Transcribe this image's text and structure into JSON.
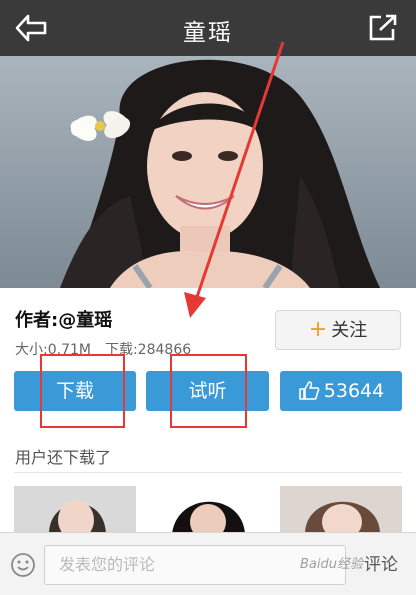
{
  "header": {
    "title": "童瑶"
  },
  "song": {
    "author": "作者:@童瑶",
    "size": "大小:0.71M",
    "downloads": "下载:284866"
  },
  "follow": {
    "label": "关注",
    "icon": "plus-icon"
  },
  "actions": {
    "download_label": "下载",
    "listen_label": "试听",
    "like_count": "53644",
    "like_icon": "thumbs-up-icon"
  },
  "related": {
    "title": "用户还下载了"
  },
  "comment": {
    "placeholder": "发表您的评论",
    "button_label": "评论",
    "emoji_icon": "smiley-icon"
  },
  "watermark": "Baidu经验",
  "colors": {
    "topbar": "#3a3a3a",
    "accent_blue": "#3a9ad8",
    "plus_orange": "#f0a020",
    "annotation_red": "#e53935"
  }
}
